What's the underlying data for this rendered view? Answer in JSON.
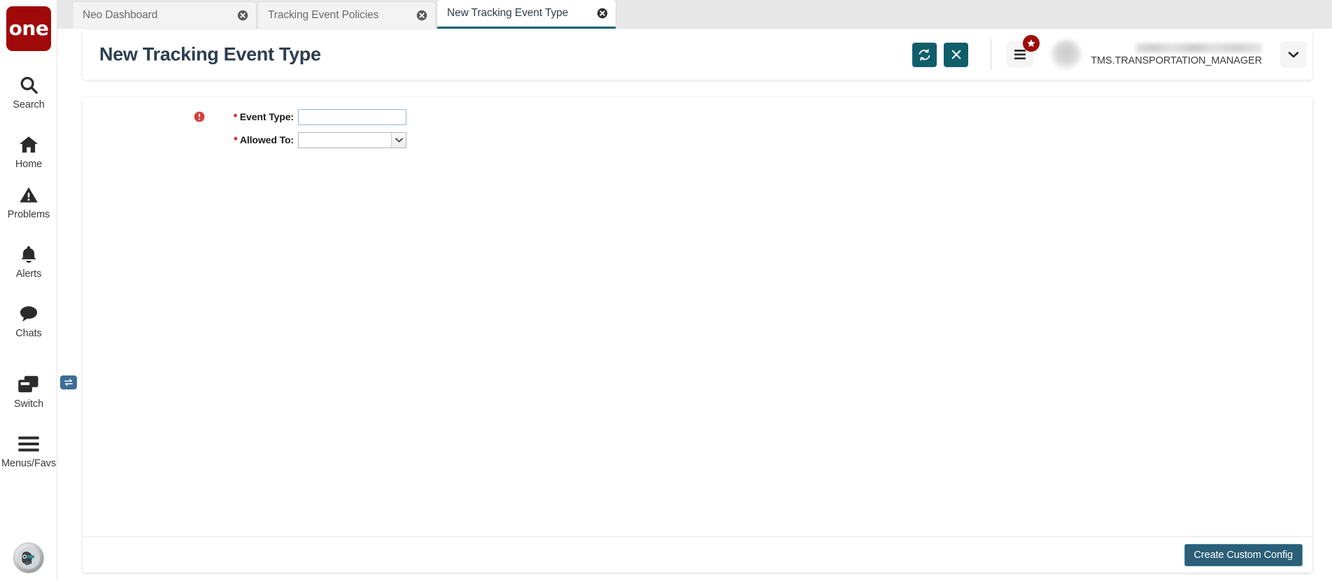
{
  "sidebar": {
    "logo_text": "one",
    "items": [
      {
        "label": "Search",
        "icon": "search-icon"
      },
      {
        "label": "Home",
        "icon": "home-icon"
      },
      {
        "label": "Problems",
        "icon": "warning-triangle-icon"
      },
      {
        "label": "Alerts",
        "icon": "bell-icon"
      },
      {
        "label": "Chats",
        "icon": "chat-bubble-icon"
      },
      {
        "label": "Switch",
        "icon": "windows-switch-icon",
        "badge_icon": "swap-arrows-icon"
      },
      {
        "label": "Menus/Favs",
        "icon": "hamburger-icon"
      }
    ],
    "bottom_avatar_icon": "ai-assistant-avatar-icon"
  },
  "tabs": [
    {
      "label": "Neo Dashboard",
      "active": false
    },
    {
      "label": "Tracking Event Policies",
      "active": false
    },
    {
      "label": "New Tracking Event Type",
      "active": true
    }
  ],
  "header": {
    "title": "New Tracking Event Type",
    "refresh_icon": "refresh-icon",
    "close_icon": "close-x-icon",
    "menus_icon": "hamburger-menu-icon",
    "star_badge_icon": "star-icon",
    "caret_icon": "chevron-down-icon",
    "user_role": "TMS.TRANSPORTATION_MANAGER"
  },
  "form": {
    "fields": [
      {
        "label": "Event Type:",
        "required": true,
        "has_error": true,
        "error_icon": "error-circle-icon",
        "type": "text",
        "value": "",
        "placeholder": ""
      },
      {
        "label": "Allowed To:",
        "required": true,
        "has_error": false,
        "type": "select",
        "value": "",
        "options": []
      }
    ]
  },
  "footer": {
    "primary_button": "Create Custom Config"
  },
  "colors": {
    "brand_red": "#a00909",
    "teal_action": "#115e6b",
    "active_tab_underline": "#126273",
    "primary_button_bg": "#2b5e77",
    "required_star": "#c00000",
    "error_red": "#d64040",
    "switch_badge_blue": "#3d6e99"
  }
}
